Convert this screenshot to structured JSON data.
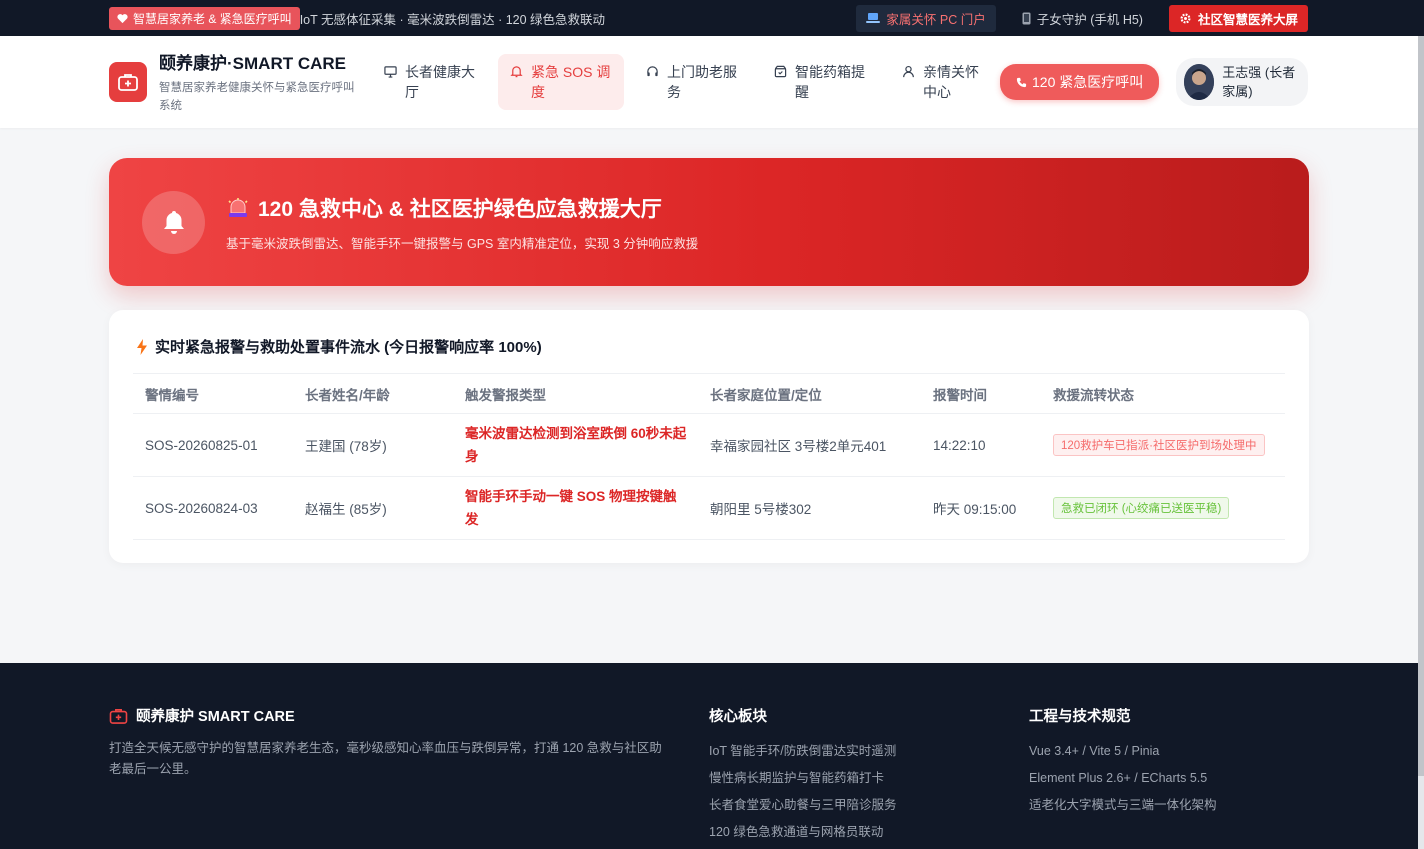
{
  "topbar": {
    "badge": "智慧居家养老 & 紧急医疗呼叫",
    "tagline": "IoT 无感体征采集 · 毫米波跌倒雷达 · 120 绿色急救联动",
    "links": [
      {
        "label": "家属关怀 PC 门户",
        "icon": "laptop-icon"
      },
      {
        "label": "子女守护 (手机 H5)",
        "icon": "mobile-icon"
      },
      {
        "label": "社区智慧医养大屏",
        "icon": "gear-icon"
      }
    ]
  },
  "header": {
    "brand_name": "颐养康护·SMART CARE",
    "brand_sub": "智慧居家养老健康关怀与紧急医疗呼叫系统",
    "nav": [
      {
        "label": "长者健康大厅",
        "icon": "monitor-icon"
      },
      {
        "label": "紧急 SOS 调度",
        "icon": "bell-icon"
      },
      {
        "label": "上门助老服务",
        "icon": "headset-icon"
      },
      {
        "label": "智能药箱提醒",
        "icon": "medicine-box-icon"
      },
      {
        "label": "亲情关怀中心",
        "icon": "user-icon"
      }
    ],
    "sos_call": "120 紧急医疗呼叫",
    "user_name": "王志强 (长者家属)"
  },
  "hero": {
    "title": "120 急救中心 & 社区医护绿色应急救援大厅",
    "subtitle": "基于毫米波跌倒雷达、智能手环一键报警与 GPS 室内精准定位，实现 3 分钟响应救援"
  },
  "events": {
    "title": "实时紧急报警与救助处置事件流水 (今日报警响应率 100%)",
    "columns": [
      "警情编号",
      "长者姓名/年龄",
      "触发警报类型",
      "长者家庭位置/定位",
      "报警时间",
      "救援流转状态"
    ],
    "rows": [
      {
        "id": "SOS-20260825-01",
        "name": "王建国 (78岁)",
        "type": "毫米波雷达检测到浴室跌倒 60秒未起身",
        "location": "幸福家园社区 3号楼2单元401",
        "time": "14:22:10",
        "status": "120救护车已指派·社区医护到场处理中",
        "status_color": "#f56c6c"
      },
      {
        "id": "SOS-20260824-03",
        "name": "赵福生 (85岁)",
        "type": "智能手环手动一键 SOS 物理按键触发",
        "location": "朝阳里 5号楼302",
        "time": "昨天 09:15:00",
        "status": "急救已闭环 (心绞痛已送医平稳)",
        "status_color": "#67c23a"
      }
    ]
  },
  "footer": {
    "brand": "颐养康护 SMART CARE",
    "desc": "打造全天候无感守护的智慧居家养老生态，毫秒级感知心率血压与跌倒异常，打通 120 急救与社区助老最后一公里。",
    "col2_title": "核心板块",
    "col2_items": [
      "IoT 智能手环/防跌倒雷达实时遥测",
      "慢性病长期监护与智能药箱打卡",
      "长者食堂爱心助餐与三甲陪诊服务",
      "120 绿色急救通道与网格员联动"
    ],
    "col3_title": "工程与技术规范",
    "col3_items": [
      "Vue 3.4+ / Vite 5 / Pinia",
      "Element Plus 2.6+ / ECharts 5.5",
      "适老化大字模式与三端一体化架构"
    ]
  },
  "colors": {
    "accent": "#e53e3e",
    "dark": "#111827",
    "success": "#67c23a"
  }
}
